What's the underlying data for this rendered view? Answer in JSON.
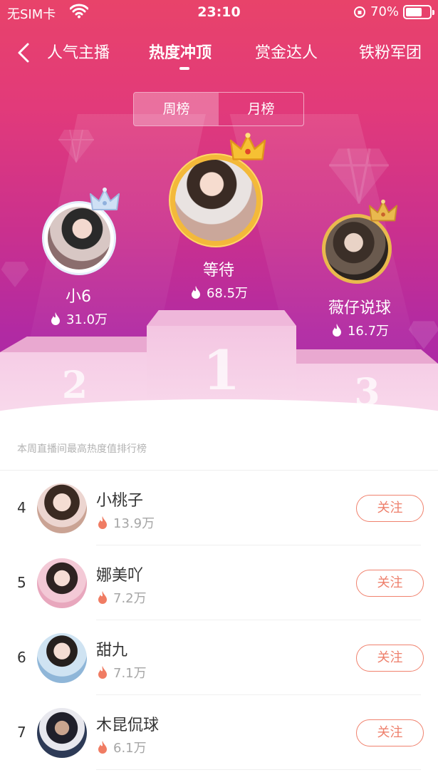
{
  "status_bar": {
    "carrier": "无SIM卡",
    "time": "23:10",
    "battery_percent": "70%",
    "battery_level": 0.7
  },
  "nav": {
    "back_icon": "chevron-left-icon",
    "tabs": [
      {
        "label": "人气主播",
        "active": false
      },
      {
        "label": "热度冲顶",
        "active": true
      },
      {
        "label": "赏金达人",
        "active": false
      },
      {
        "label": "铁粉军团",
        "active": false
      }
    ]
  },
  "period_toggle": {
    "options": [
      {
        "label": "周榜",
        "active": true
      },
      {
        "label": "月榜",
        "active": false
      }
    ]
  },
  "podium": {
    "first": {
      "rank": "1",
      "name": "等待",
      "heat": "68.5万",
      "crown_color": "#f6c133"
    },
    "second": {
      "rank": "2",
      "name": "小6",
      "heat": "31.0万",
      "crown_color": "#cfe0f5"
    },
    "third": {
      "rank": "3",
      "name": "薇仔说球",
      "heat": "16.7万",
      "crown_color": "#e9b94e"
    }
  },
  "subtitle": "本周直播间最高热度值排行榜",
  "list": [
    {
      "rank": "4",
      "name": "小桃子",
      "heat": "13.9万",
      "follow_label": "关注"
    },
    {
      "rank": "5",
      "name": "娜美吖",
      "heat": "7.2万",
      "follow_label": "关注"
    },
    {
      "rank": "6",
      "name": "甜九",
      "heat": "7.1万",
      "follow_label": "关注"
    },
    {
      "rank": "7",
      "name": "木昆侃球",
      "heat": "6.1万",
      "follow_label": "关注"
    }
  ],
  "colors": {
    "accent": "#ee7f6b",
    "hero_top": "#e8436a",
    "hero_bottom": "#a52ba6"
  }
}
